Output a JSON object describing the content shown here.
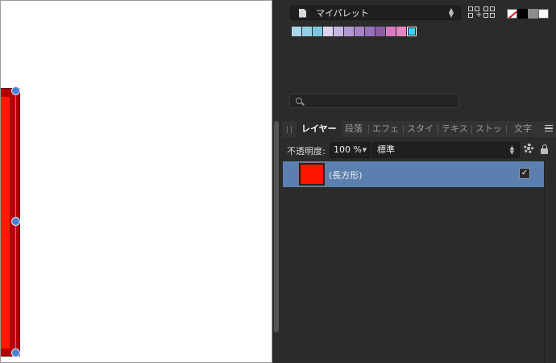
{
  "palette": {
    "name": "マイパレット",
    "swatches": [
      "#a9d6ec",
      "#94cfe6",
      "#7fc4df",
      "#dcd3ef",
      "#c6b6e3",
      "#b399d4",
      "#a584c6",
      "#9670b8",
      "#8c5ea6",
      "#d77bc2",
      "#e585c0",
      "#2fd7ff"
    ],
    "selected_index": 11,
    "gray_swatches": [
      "#000000",
      "#8c8c8c",
      "#ffffff"
    ]
  },
  "search": {
    "placeholder": ""
  },
  "tabs": [
    {
      "label": "レイヤー",
      "active": true
    },
    {
      "label": "段落",
      "active": false
    },
    {
      "label": "エフェ",
      "active": false
    },
    {
      "label": "スタイ",
      "active": false
    },
    {
      "label": "テキス",
      "active": false
    },
    {
      "label": "ストッ",
      "active": false
    },
    {
      "label": "文字",
      "active": false
    }
  ],
  "layer_controls": {
    "opacity_label": "不透明度:",
    "opacity_value": "100 %",
    "blend_mode": "標準"
  },
  "layers": [
    {
      "name": "(長方形)",
      "color": "#ff1400",
      "visible_checked": "✓"
    }
  ],
  "colors": {
    "canvas_bg": "#ffffff",
    "shape_fill": "#ff1a00",
    "selection_handle": "#4a7fd6",
    "layer_selected_bg": "#5b7fae",
    "panel_bg": "#2b2b2b"
  }
}
